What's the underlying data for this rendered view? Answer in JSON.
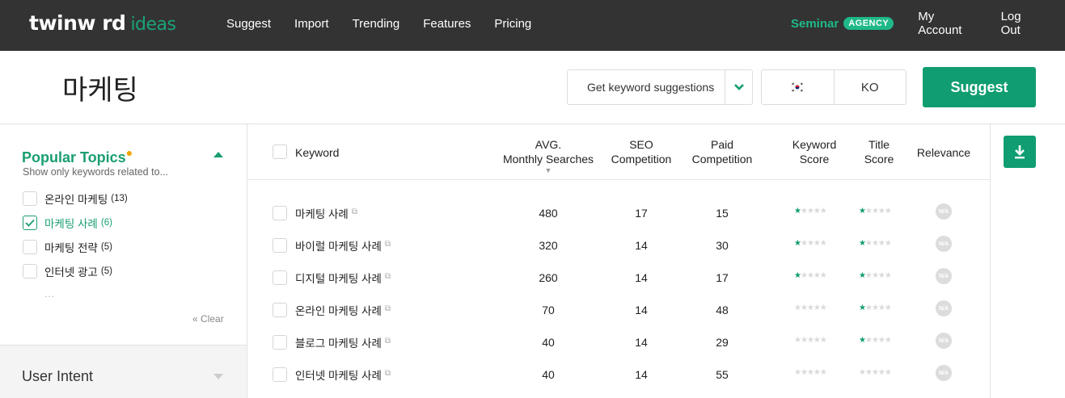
{
  "brand": {
    "name": "twinw rd",
    "suffix": "ideas",
    "accent": "#0f9d71"
  },
  "nav": {
    "left": [
      "Suggest",
      "Import",
      "Trending",
      "Features",
      "Pricing"
    ],
    "seminar": "Seminar",
    "badge": "AGENCY",
    "account": "My Account",
    "logout": "Log Out"
  },
  "query": {
    "title": "마케팅",
    "mode": "Get keyword suggestions",
    "flag": "🇰🇷",
    "language": "KO",
    "suggest_label": "Suggest"
  },
  "sidebar": {
    "popular_title": "Popular Topics",
    "popular_sub": "Show only keywords related to...",
    "topics": [
      {
        "label": "온라인 마케팅",
        "count": "(13)",
        "checked": false
      },
      {
        "label": "마케팅 사례",
        "count": "(6)",
        "checked": true
      },
      {
        "label": "마케팅 전략",
        "count": "(5)",
        "checked": false
      },
      {
        "label": "인터넷 광고",
        "count": "(5)",
        "checked": false
      }
    ],
    "more": "...",
    "clear": "« Clear",
    "intent_title": "User Intent"
  },
  "table": {
    "headers": {
      "keyword": "Keyword",
      "avg_1": "AVG.",
      "avg_2": "Monthly Searches",
      "sort": "▼",
      "seo_1": "SEO",
      "seo_2": "Competition",
      "paid_1": "Paid",
      "paid_2": "Competition",
      "kscore_1": "Keyword",
      "kscore_2": "Score",
      "tscore_1": "Title",
      "tscore_2": "Score",
      "relevance": "Relevance"
    },
    "na_label": "N/A",
    "rows": [
      {
        "keyword": "마케팅 사례",
        "searches": "480",
        "seo": "17",
        "paid": "15",
        "keyword_score": 1,
        "title_score": 1
      },
      {
        "keyword": "바이럴 마케팅 사례",
        "searches": "320",
        "seo": "14",
        "paid": "30",
        "keyword_score": 1,
        "title_score": 1
      },
      {
        "keyword": "디지털 마케팅 사례",
        "searches": "260",
        "seo": "14",
        "paid": "17",
        "keyword_score": 1,
        "title_score": 1
      },
      {
        "keyword": "온라인 마케팅 사례",
        "searches": "70",
        "seo": "14",
        "paid": "48",
        "keyword_score": 0,
        "title_score": 1
      },
      {
        "keyword": "블로그 마케팅 사례",
        "searches": "40",
        "seo": "14",
        "paid": "29",
        "keyword_score": 0,
        "title_score": 1
      },
      {
        "keyword": "인터넷 마케팅 사례",
        "searches": "40",
        "seo": "14",
        "paid": "55",
        "keyword_score": 0,
        "title_score": 0
      }
    ]
  },
  "icons": {
    "download": "download-icon",
    "chevron": "chevron-down-icon",
    "external": "external-link-icon",
    "check": "check-icon"
  }
}
